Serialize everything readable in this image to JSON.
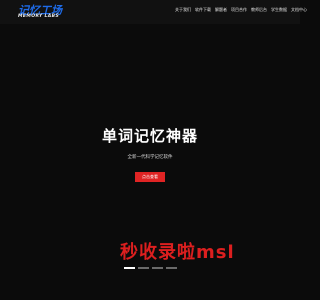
{
  "brand": {
    "logo_text": "记忆工场",
    "logo_subtext": "MEMORY LABS",
    "accent": "#1e6be8"
  },
  "nav": {
    "items": [
      {
        "label": "关于我们"
      },
      {
        "label": "软件下载"
      },
      {
        "label": "解题者"
      },
      {
        "label": "项目合作"
      },
      {
        "label": "教师后台"
      },
      {
        "label": "学生数据"
      },
      {
        "label": "文档中心"
      }
    ]
  },
  "hero": {
    "title": "单词记忆神器",
    "subtitle": "全新一代科学记忆软件",
    "cta_label": "点击查看",
    "cta_color": "#e02424",
    "background": "#0b0b0b"
  },
  "watermark": {
    "text": "秒收录啦msl",
    "color": "#dc1f1f"
  },
  "carousel": {
    "total": 4,
    "active_index": 0
  }
}
